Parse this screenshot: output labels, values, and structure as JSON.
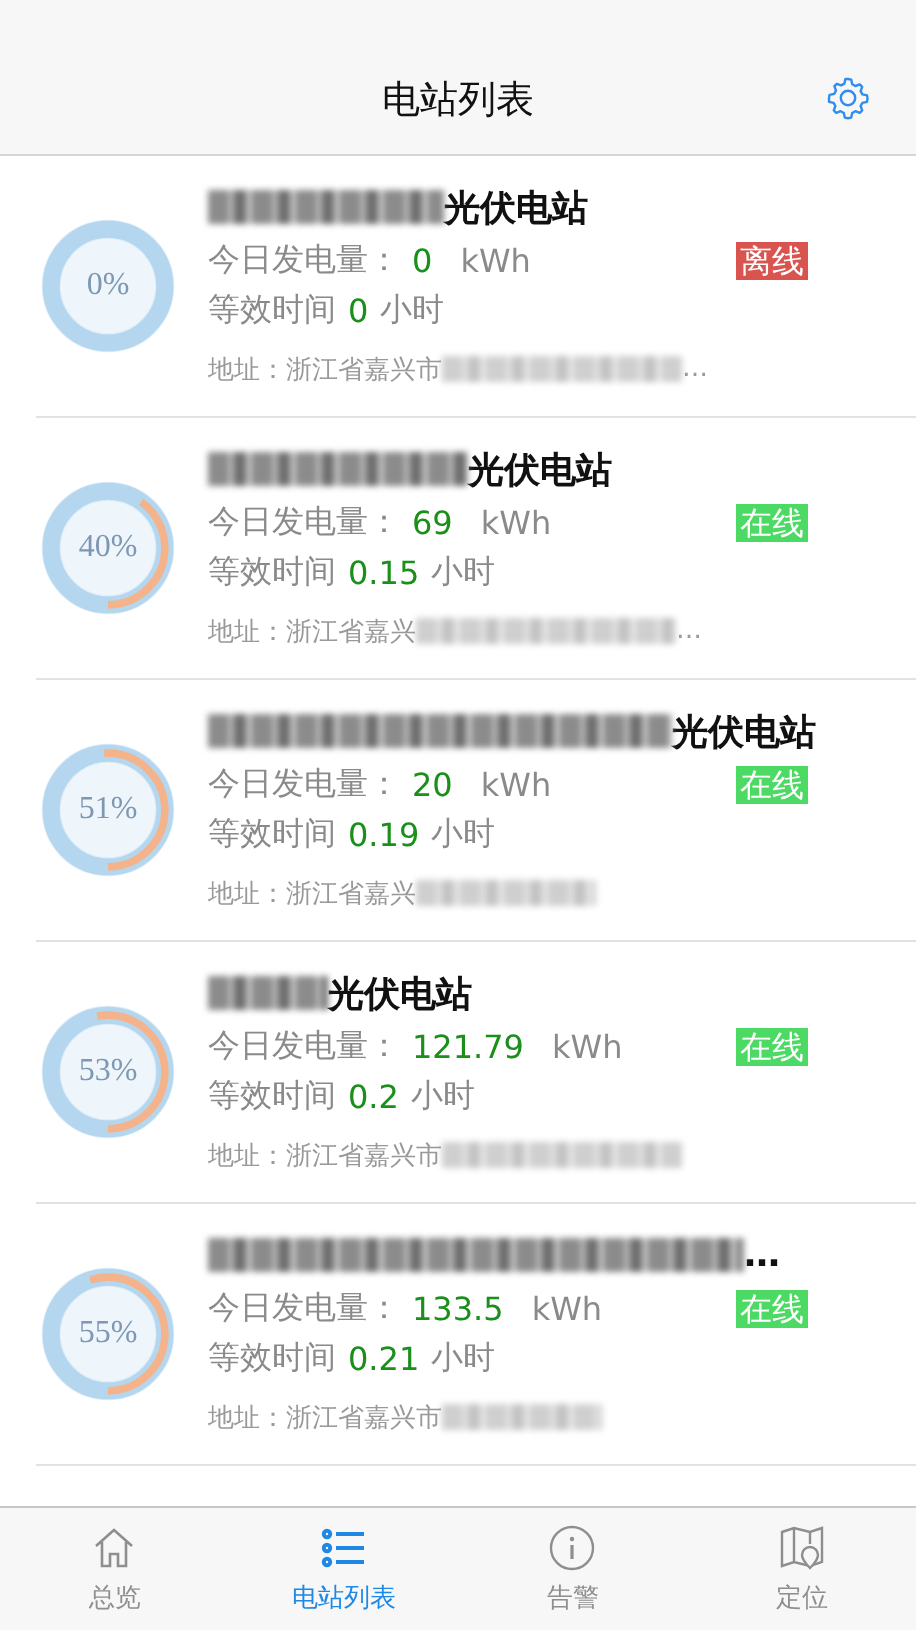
{
  "header": {
    "title": "电站列表"
  },
  "stations": [
    {
      "name": "光伏电站",
      "percent": "0%",
      "level": 0,
      "energy_label": "今日发电量：",
      "energy": "0",
      "energy_unit": "kWh",
      "hours_label": "等效时间",
      "hours": "0",
      "hours_unit": "小时",
      "status": "离线",
      "online": false,
      "address": "地址：浙江省嘉兴市",
      "address_tail": "…"
    },
    {
      "name": "光伏电站",
      "percent": "40%",
      "level": 0.4,
      "energy_label": "今日发电量：",
      "energy": "69",
      "energy_unit": "kWh",
      "hours_label": "等效时间",
      "hours": "0.15",
      "hours_unit": "小时",
      "status": "在线",
      "online": true,
      "address": "地址：浙江省嘉兴",
      "address_tail": "…"
    },
    {
      "name": "光伏电站",
      "percent": "51%",
      "level": 0.51,
      "energy_label": "今日发电量：",
      "energy": "20",
      "energy_unit": "kWh",
      "hours_label": "等效时间",
      "hours": "0.19",
      "hours_unit": "小时",
      "status": "在线",
      "online": true,
      "address": "地址：浙江省嘉兴"
    },
    {
      "name": "光伏电站",
      "percent": "53%",
      "level": 0.53,
      "energy_label": "今日发电量：",
      "energy": "121.79",
      "energy_unit": "kWh",
      "hours_label": "等效时间",
      "hours": "0.2",
      "hours_unit": "小时",
      "status": "在线",
      "online": true,
      "address": "地址：浙江省嘉兴市"
    },
    {
      "name": "…",
      "percent": "55%",
      "level": 0.55,
      "energy_label": "今日发电量：",
      "energy": "133.5",
      "energy_unit": "kWh",
      "hours_label": "等效时间",
      "hours": "0.21",
      "hours_unit": "小时",
      "status": "在线",
      "online": true,
      "address": "地址：浙江省嘉兴市"
    }
  ],
  "tabs": [
    {
      "label": "总览",
      "kind": "home",
      "selected": false
    },
    {
      "label": "电站列表",
      "kind": "list",
      "selected": true
    },
    {
      "label": "告警",
      "kind": "info",
      "selected": false
    },
    {
      "label": "定位",
      "kind": "map",
      "selected": false
    }
  ]
}
